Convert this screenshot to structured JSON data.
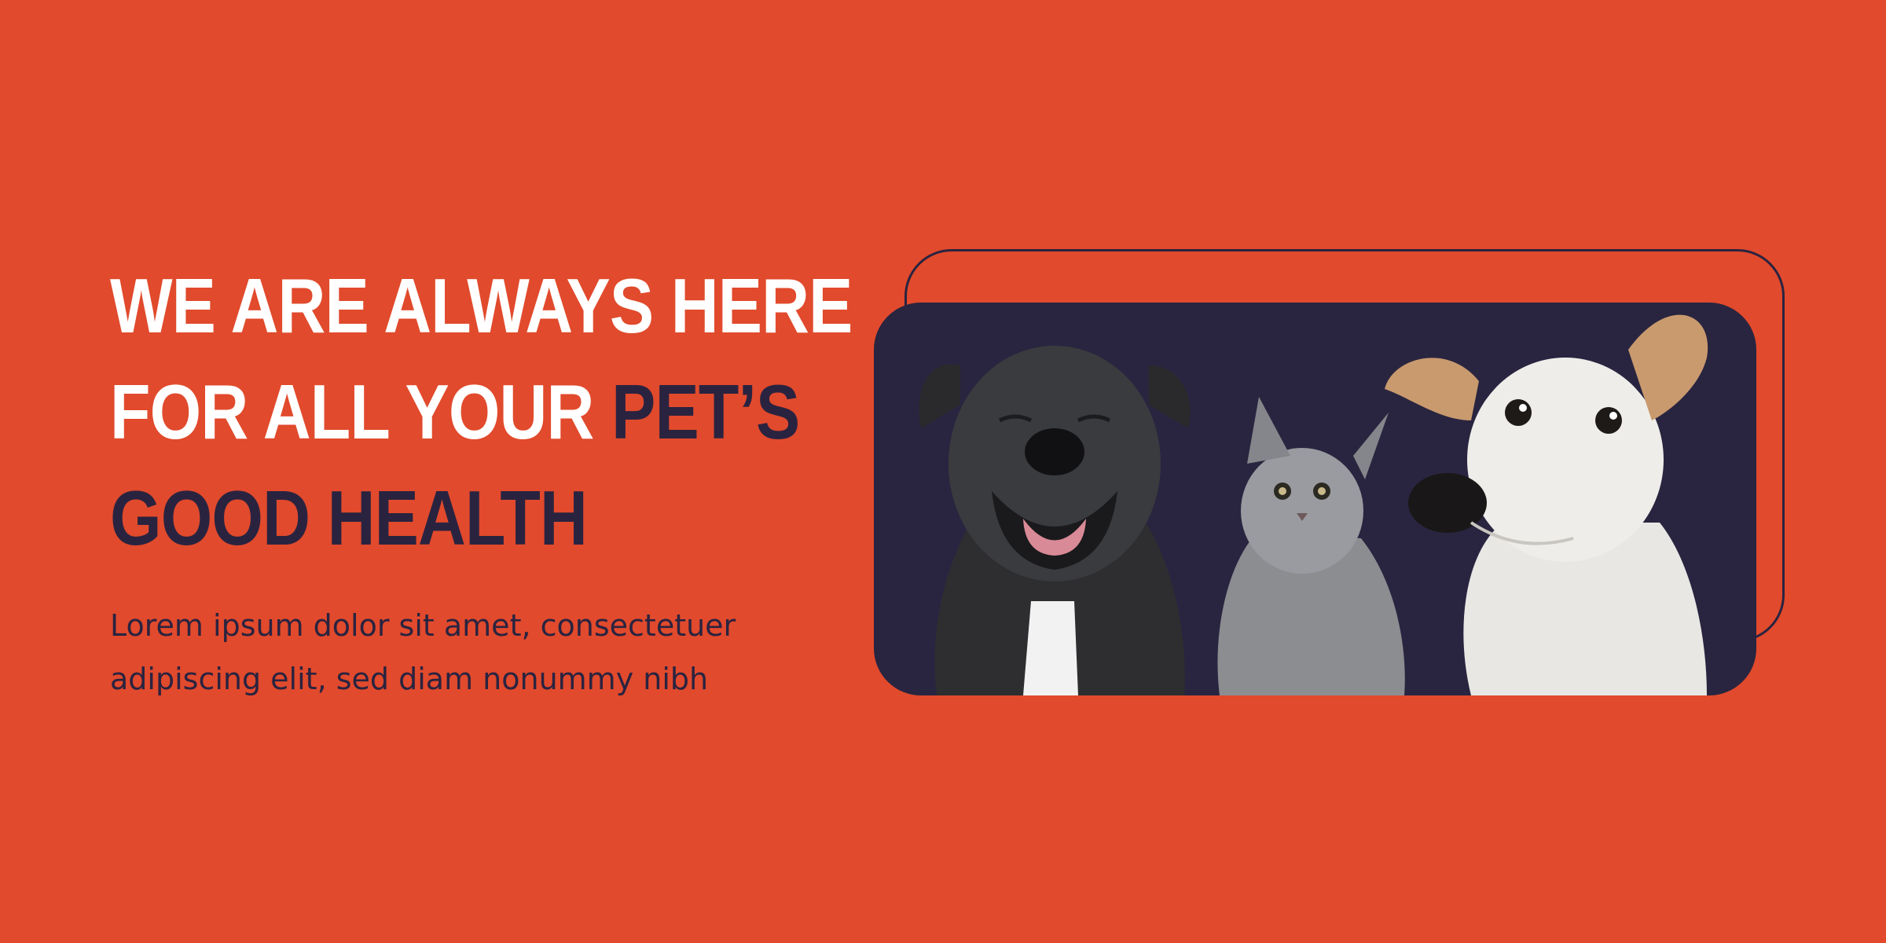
{
  "hero": {
    "headline_line1": "WE ARE ALWAYS HERE",
    "headline_line2_start": "FOR ALL YOUR",
    "headline_line2_end": "PET’S",
    "headline_line3": "GOOD HEALTH",
    "body_line1": "Lorem ipsum dolor sit amet, consectetuer",
    "body_line2": "adipiscing elit, sed diam nonummy nibh"
  },
  "colors": {
    "background": "#e14a2c",
    "accent_dark": "#2a2340",
    "text_light": "#ffffff"
  },
  "image": {
    "subjects": [
      "dog-pitbull",
      "cat-gray-kitten",
      "dog-jack-russell"
    ]
  }
}
